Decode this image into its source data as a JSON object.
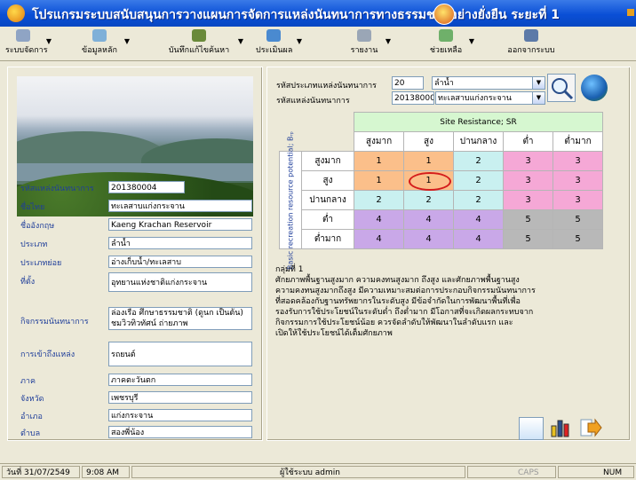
{
  "window": {
    "title": "โปรแกรมระบบสนับสนุนการวางแผนการจัดการแหล่งนันทนาการทางธรรมชาติอย่างยั่งยืน ระยะที่ 1"
  },
  "toolbar": {
    "items": [
      {
        "label": "ระบบจัดการ",
        "icon": "settings-icon"
      },
      {
        "label": "ข้อมูลหลัก",
        "icon": "database-icon"
      },
      {
        "label": "บันทึกแก้ไขค้นหา",
        "icon": "edit-icon"
      },
      {
        "label": "ประเมินผล",
        "icon": "evaluate-icon"
      },
      {
        "label": "รายงาน",
        "icon": "report-icon"
      },
      {
        "label": "ช่วยเหลือ",
        "icon": "help-icon"
      },
      {
        "label": "ออกจากระบบ",
        "icon": "exit-icon"
      }
    ]
  },
  "details": {
    "site_code_label": "รหัสแหล่งนันทนาการ",
    "site_code": "201380004",
    "thai_name_label": "ชื่อไทย",
    "thai_name": "ทะเลสาบแก่งกระจาน",
    "english_name_label": "ชื่ออังกฤษ",
    "english_name": "Kaeng Krachan Reservoir",
    "type_label": "ประเภท",
    "type": "ลำน้ำ",
    "subtype_label": "ประเภทย่อย",
    "subtype": "อ่างเก็บน้ำ/ทะเลสาบ",
    "location_label": "ที่ตั้ง",
    "location": "อุทยานแห่งชาติแก่งกระจาน",
    "activity_label": "กิจกรรมนันทนาการ",
    "activity": "ล่องเรือ ศึกษาธรรมชาติ (ดูนก เป็นต้น) ชมวิวทิวทัศน์ ถ่ายภาพ",
    "access_label": "การเข้าถึงแหล่ง",
    "access": "รถยนต์",
    "region_label": "ภาค",
    "region": "ภาคตะวันตก",
    "province_label": "จังหวัด",
    "province": "เพชรบุรี",
    "district_label": "อำเภอ",
    "district": "แก่งกระจาน",
    "subdistrict_label": "ตำบล",
    "subdistrict": "สองพี่น้อง"
  },
  "filter": {
    "type_code_label": "รหัสประเภทแหล่งนันทนาการ",
    "type_code": "20",
    "type_name": "ลำน้ำ",
    "site_code_label": "รหัสแหล่งนันทนาการ",
    "site_code": "201380004",
    "site_name": "ทะเลสาบแก่งกระจาน"
  },
  "matrix": {
    "sr_header": "Site Resistance; SR",
    "row_axis": "Basic recreation resource potential; Bᵣₚ",
    "columns": [
      "สูงมาก",
      "สูง",
      "ปานกลาง",
      "ต่ำ",
      "ต่ำมาก"
    ],
    "rows": [
      {
        "label": "สูงมาก",
        "cells": [
          "1",
          "1",
          "2",
          "3",
          "3"
        ]
      },
      {
        "label": "สูง",
        "cells": [
          "1",
          "1",
          "2",
          "3",
          "3"
        ]
      },
      {
        "label": "ปานกลาง",
        "cells": [
          "2",
          "2",
          "2",
          "3",
          "3"
        ]
      },
      {
        "label": "ต่ำ",
        "cells": [
          "4",
          "4",
          "4",
          "5",
          "5"
        ]
      },
      {
        "label": "ต่ำมาก",
        "cells": [
          "4",
          "4",
          "4",
          "5",
          "5"
        ]
      }
    ],
    "highlight": {
      "row": 1,
      "col": 1,
      "color": "#d41c1c"
    },
    "group_colors": {
      "1": "#fbbf8a",
      "2": "#c9f0f0",
      "3": "#f5a8d6",
      "4": "#c9a8e8",
      "5": "#b8b8b8"
    }
  },
  "result": {
    "group": "กลุ่มที่ 1",
    "lines": [
      "ศักยภาพพื้นฐานสูงมาก ความคงทนสูงมาก ถึงสูง และศักยภาพพื้นฐานสูง",
      "ความคงทนสูงมากถึงสูง มีความเหมาะสมต่อการประกอบกิจกรรมนันทนาการ",
      "ที่สอดคล้องกับฐานทรัพยากรในระดับสูง มีข้อจำกัดในการพัฒนาพื้นที่เพื่อ",
      "รองรับการใช้ประโยชน์ในระดับต่ำ ถึงต่ำมาก มีโอกาสที่จะเกิดผลกระทบจาก",
      "กิจกรรมการใช้ประโยชน์น้อย ควรจัดลำดับให้พัฒนาในลำดับแรก และ",
      "เปิดให้ใช้ประโยชน์ได้เต็มศักยภาพ"
    ]
  },
  "status": {
    "date": "วันที่ 31/07/2549",
    "time": "9:08 AM",
    "user": "ผู้ใช้ระบบ admin",
    "caps": "CAPS",
    "num": "NUM"
  }
}
